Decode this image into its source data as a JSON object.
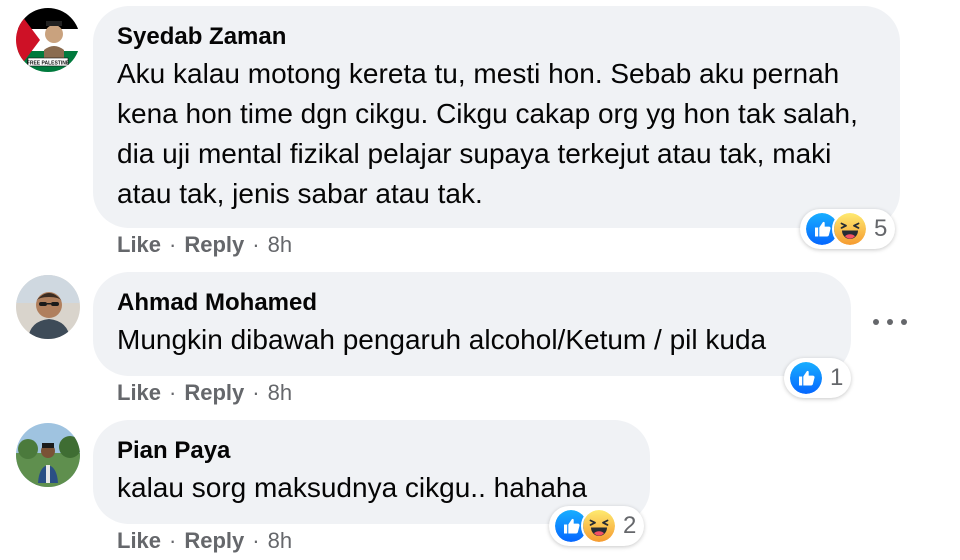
{
  "comments": [
    {
      "author": "Syedab Zaman",
      "text": "Aku kalau motong kereta tu, mesti hon. Sebab aku pernah kena hon time dgn cikgu. Cikgu cakap org yg hon tak salah, dia uji mental fizikal pelajar supaya terkejut atau tak, maki atau tak, jenis sabar atau tak.",
      "like_label": "Like",
      "reply_label": "Reply",
      "time": "8h",
      "reactions": [
        "like-icon",
        "haha-icon"
      ],
      "reaction_count": "5",
      "avatar_badge_text": "FREE PALESTINE"
    },
    {
      "author": "Ahmad Mohamed",
      "text": "Mungkin dibawah pengaruh alcohol/Ketum / pil kuda",
      "like_label": "Like",
      "reply_label": "Reply",
      "time": "8h",
      "reactions": [
        "like-icon"
      ],
      "reaction_count": "1"
    },
    {
      "author": "Pian Paya",
      "text": "kalau sorg maksudnya cikgu.. hahaha",
      "like_label": "Like",
      "reply_label": "Reply",
      "time": "8h",
      "reactions": [
        "like-icon",
        "haha-icon"
      ],
      "reaction_count": "2"
    }
  ],
  "colors": {
    "bubble_bg": "#f0f2f5",
    "meta_text": "#65676b",
    "like_blue": "#1877f2",
    "haha_yellow": "#f7b125"
  },
  "icons": {
    "more_options": "more-options-icon"
  },
  "separator": "·"
}
